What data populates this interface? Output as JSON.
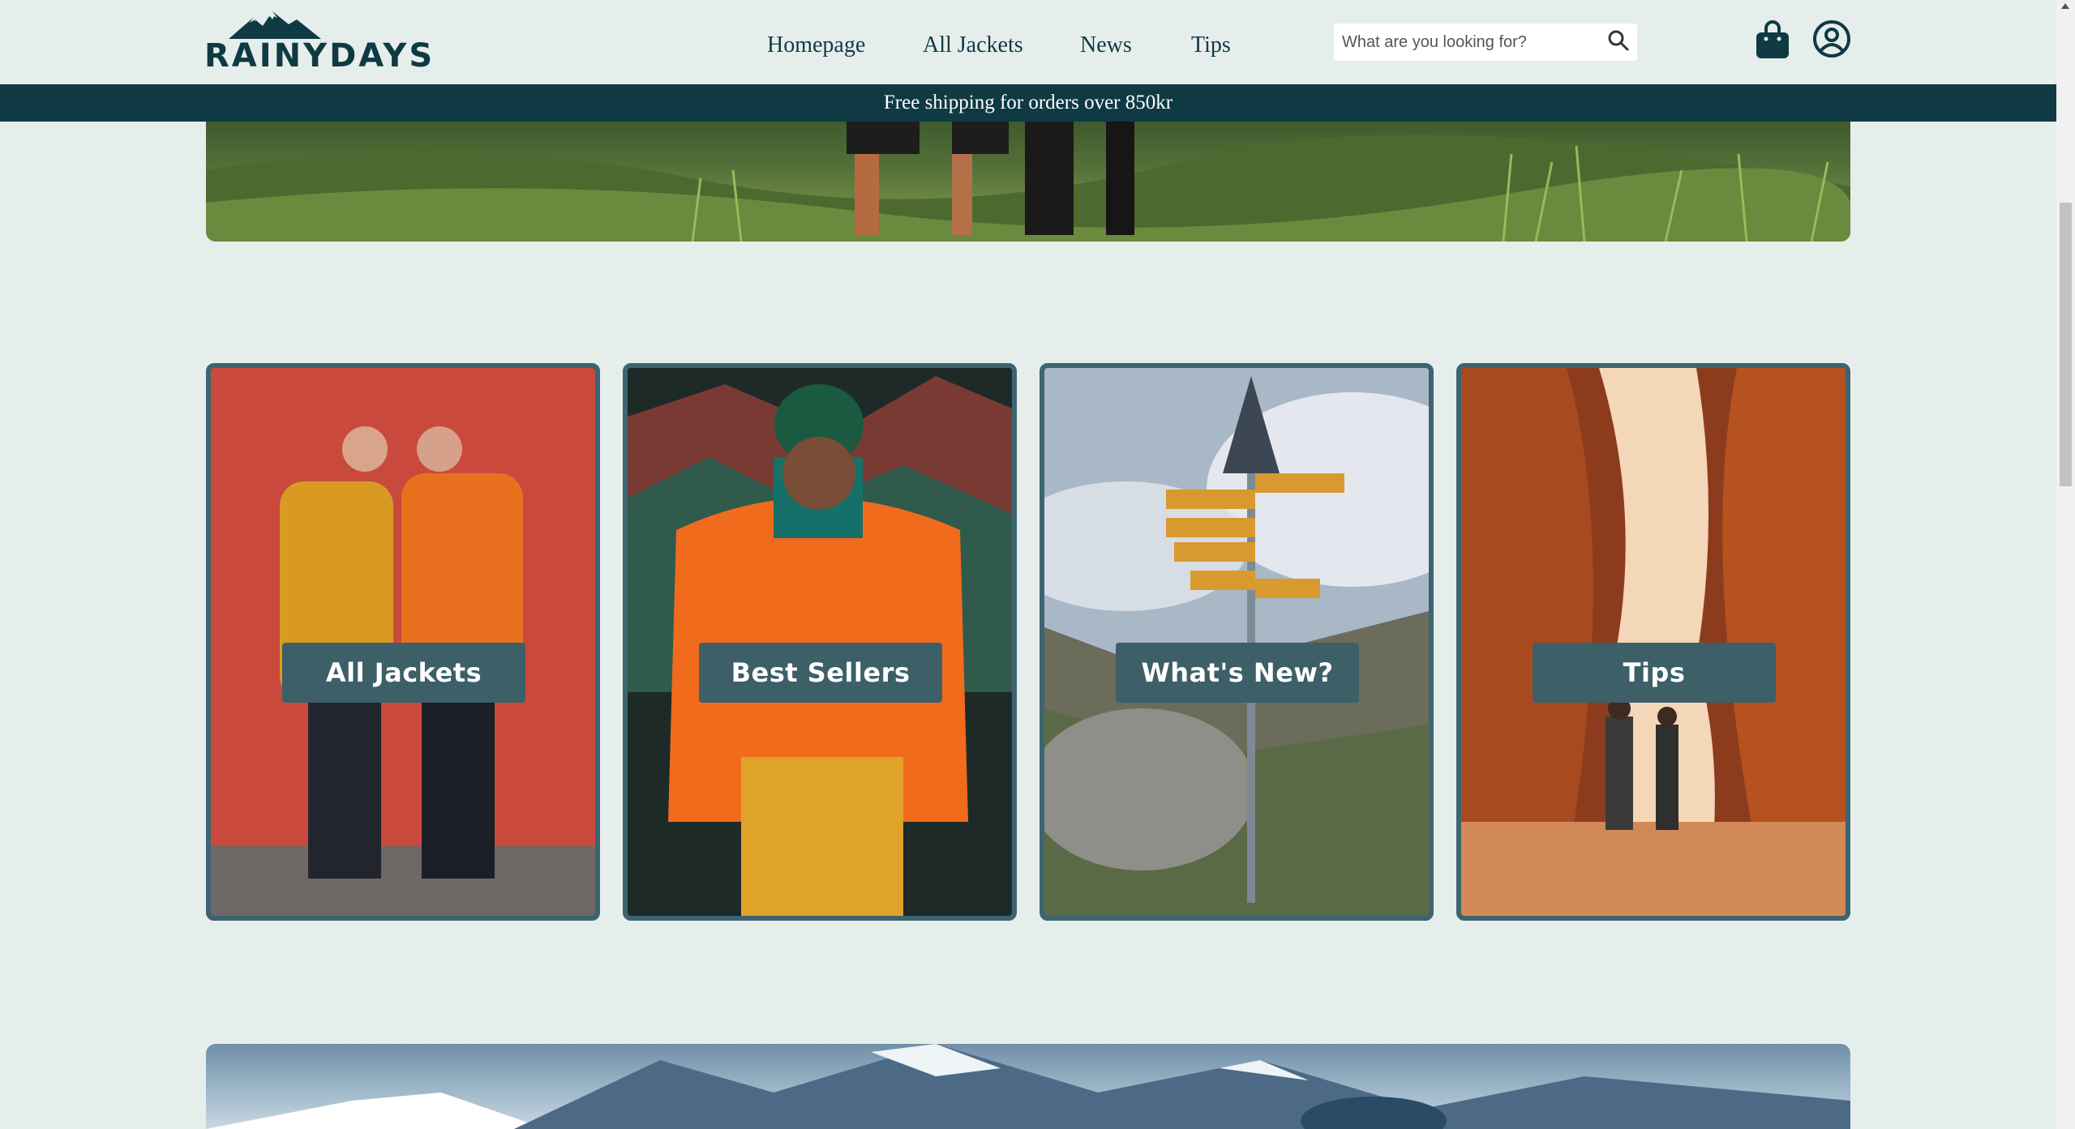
{
  "header": {
    "logo_text": "RAINYDAYS",
    "nav": [
      {
        "label": "Homepage"
      },
      {
        "label": "All Jackets"
      },
      {
        "label": "News"
      },
      {
        "label": "Tips"
      }
    ],
    "search": {
      "placeholder": "What are you looking for?",
      "value": ""
    },
    "icons": {
      "search": "search-icon",
      "bag": "shopping-bag-icon",
      "account": "user-account-icon"
    }
  },
  "banner": {
    "shipping_text": "Free shipping for orders over 850kr"
  },
  "categories": [
    {
      "label": "All Jackets"
    },
    {
      "label": "Best Sellers"
    },
    {
      "label": "What's New?"
    },
    {
      "label": "Tips"
    }
  ],
  "colors": {
    "brand_dark": "#0f3a44",
    "page_bg": "#e6eeec",
    "card_border": "#3d6470",
    "card_label_bg": "#3c5f68"
  }
}
